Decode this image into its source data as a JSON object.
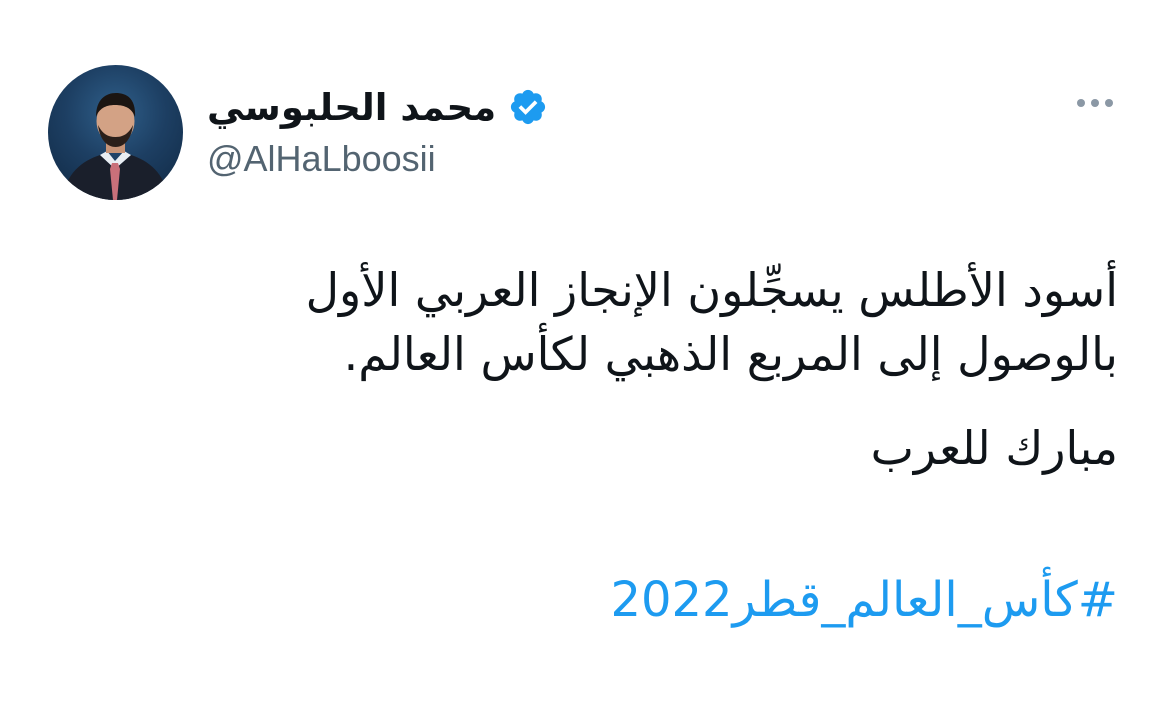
{
  "author": {
    "display_name": "محمد الحلبوسي",
    "handle": "@AlHaLboosii",
    "verified_icon": "verified-badge-icon",
    "avatar": "profile-photo"
  },
  "more_menu": {
    "icon": "more-horizontal-icon"
  },
  "tweet": {
    "lines": [
      "أسود الأطلس يسجِّلون الإنجاز العربي الأول",
      "بالوصول إلى المربع الذهبي لكأس العالم."
    ],
    "paragraph_2": "مبارك للعرب",
    "hashtag": "#كأس_العالم_قطر2022"
  },
  "colors": {
    "text_primary": "#0f1419",
    "text_secondary": "#536471",
    "link": "#1d9bf0",
    "verified": "#1d9bf0",
    "background": "#ffffff"
  }
}
